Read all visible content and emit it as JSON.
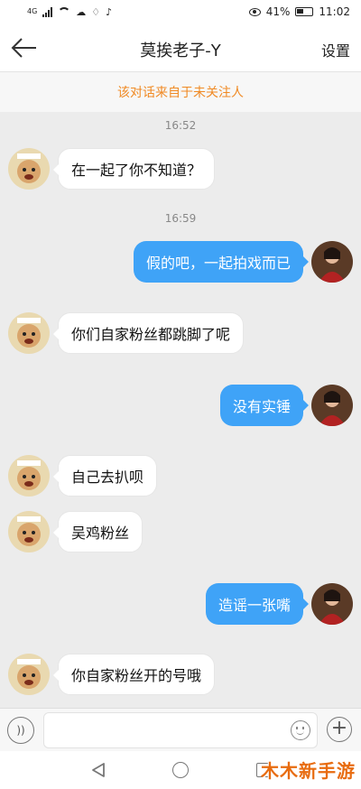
{
  "status_bar": {
    "net_type": "4G",
    "battery": "41%",
    "time": "11:02"
  },
  "header": {
    "title": "莫挨老子-Y",
    "settings_label": "设置"
  },
  "notice": {
    "text": "该对话来自于未关注人"
  },
  "messages": [
    {
      "type": "time",
      "text": "16:52"
    },
    {
      "type": "in",
      "text": "在一起了你不知道？"
    },
    {
      "type": "time",
      "text": "16:59"
    },
    {
      "type": "out",
      "text": "假的吧，一起拍戏而已"
    },
    {
      "type": "in",
      "text": "你们自家粉丝都跳脚了呢"
    },
    {
      "type": "out",
      "text": "没有实锤"
    },
    {
      "type": "in",
      "text": "自己去扒呗"
    },
    {
      "type": "in",
      "text": "吴鸡粉丝"
    },
    {
      "type": "out",
      "text": "造谣一张嘴"
    },
    {
      "type": "in",
      "text": "你自家粉丝开的号哦"
    }
  ],
  "input": {
    "value": "",
    "placeholder": ""
  },
  "watermark": "木木新手游",
  "colors": {
    "accent_blue": "#3fa3f7",
    "notice_orange": "#f08a24",
    "watermark_orange": "#e86c10"
  }
}
